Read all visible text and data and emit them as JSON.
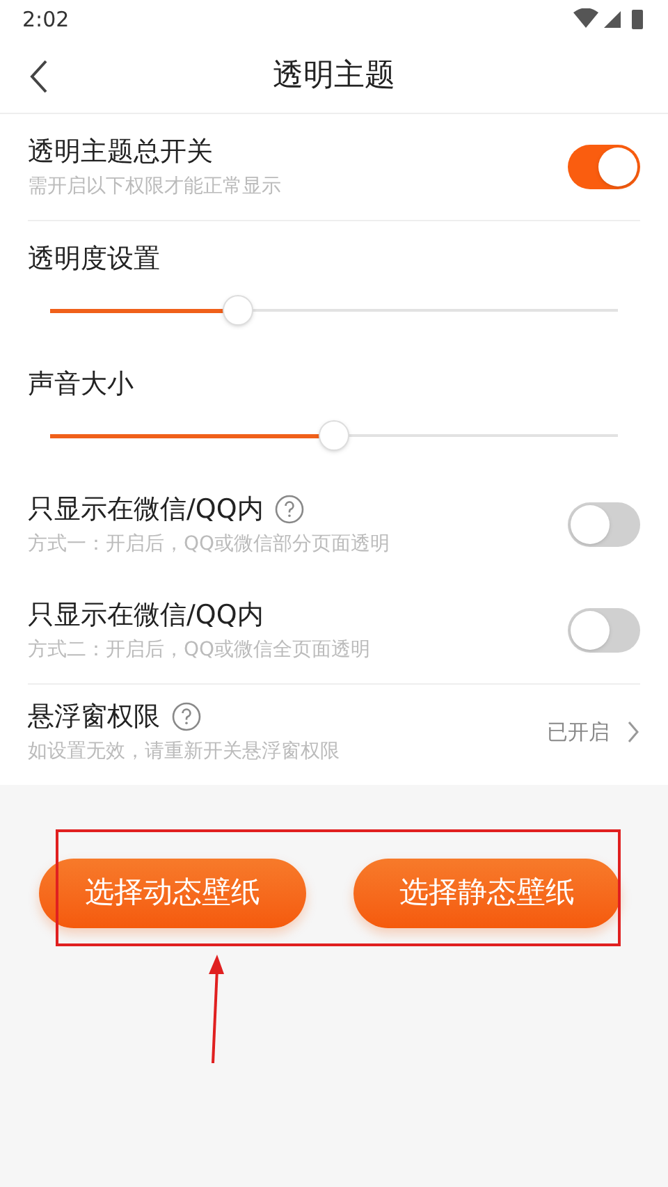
{
  "status_bar": {
    "time": "2:02"
  },
  "header": {
    "title": "透明主题"
  },
  "settings": [
    {
      "kind": "toggle",
      "title": "透明主题总开关",
      "subtitle": "需开启以下权限才能正常显示",
      "on": true,
      "help": false,
      "divider": true
    },
    {
      "kind": "slider",
      "title": "透明度设置",
      "level": 0.33
    },
    {
      "kind": "slider",
      "title": "声音大小",
      "level": 0.5
    },
    {
      "kind": "toggle",
      "title": "只显示在微信/QQ内",
      "subtitle": "方式一：开启后，QQ或微信部分页面透明",
      "on": false,
      "help": true,
      "divider": false
    },
    {
      "kind": "toggle",
      "title": "只显示在微信/QQ内",
      "subtitle": "方式二：开启后，QQ或微信全页面透明",
      "on": false,
      "help": false,
      "divider": true
    },
    {
      "kind": "link",
      "title": "悬浮窗权限",
      "subtitle": "如设置无效，请重新开关悬浮窗权限",
      "value": "已开启",
      "help": true
    }
  ],
  "buttons": [
    "选择动态壁纸",
    "选择静态壁纸"
  ]
}
